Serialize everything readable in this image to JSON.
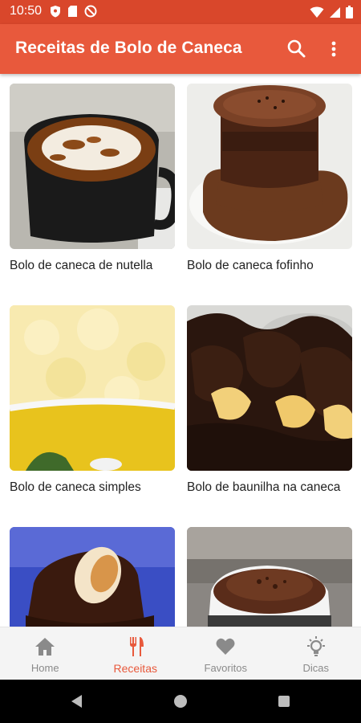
{
  "status_bar": {
    "time": "10:50"
  },
  "app_bar": {
    "title": "Receitas de Bolo de Caneca"
  },
  "recipes": [
    {
      "title": "Bolo de caneca de nutella"
    },
    {
      "title": "Bolo de caneca fofinho"
    },
    {
      "title": "Bolo de caneca simples"
    },
    {
      "title": "Bolo de baunilha na caneca"
    },
    {
      "title": ""
    },
    {
      "title": ""
    }
  ],
  "bottom_nav": {
    "items": [
      {
        "label": "Home",
        "icon": "home-icon"
      },
      {
        "label": "Receitas",
        "icon": "fork-knife-icon",
        "active": true
      },
      {
        "label": "Favoritos",
        "icon": "heart-icon"
      },
      {
        "label": "Dicas",
        "icon": "lightbulb-icon"
      }
    ]
  },
  "colors": {
    "status_bar": "#d9472b",
    "app_bar": "#e8593c",
    "accent": "#e8593c",
    "nav_inactive": "#8a8a8a"
  }
}
